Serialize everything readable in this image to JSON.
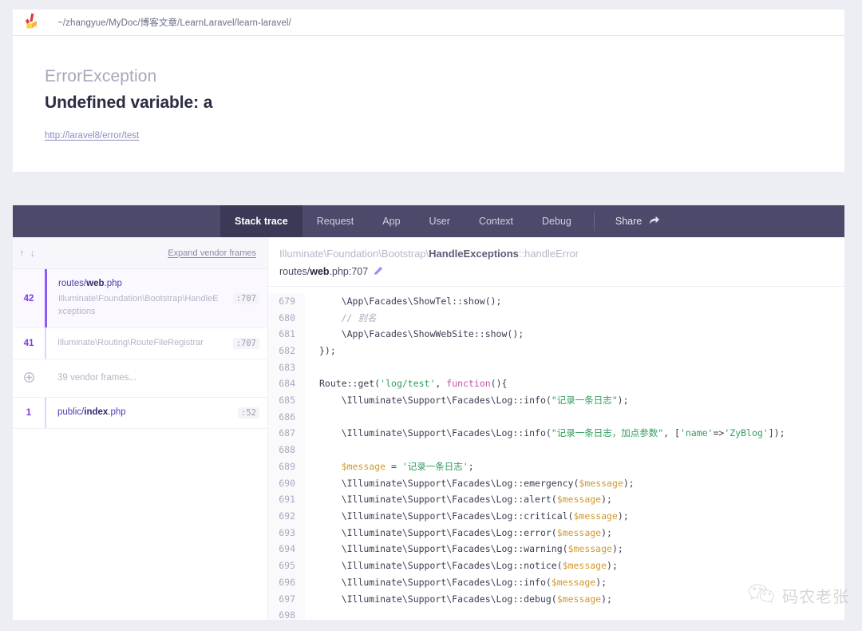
{
  "pathbar": {
    "logo_icon": "laravel-ignition-logo",
    "path": "~/zhangyue/MyDoc/博客文章/LearnLaravel/learn-laravel/"
  },
  "error": {
    "exception_class": "ErrorException",
    "message": "Undefined variable: a",
    "url": "http://laravel8/error/test"
  },
  "tabs": [
    {
      "label": "Stack trace",
      "active": true
    },
    {
      "label": "Request",
      "active": false
    },
    {
      "label": "App",
      "active": false
    },
    {
      "label": "User",
      "active": false
    },
    {
      "label": "Context",
      "active": false
    },
    {
      "label": "Debug",
      "active": false
    }
  ],
  "share": {
    "label": "Share",
    "icon": "share-arrow-icon"
  },
  "frames_panel": {
    "sort_up_icon": "arrow-up-icon",
    "sort_down_icon": "arrow-down-icon",
    "expand_vendor_label": "Expand vendor frames",
    "frames": [
      {
        "number": "42",
        "file": "routes/web.php",
        "file_prefix": "routes/",
        "file_bold": "web",
        "file_suffix": ".php",
        "class": "Illuminate\\Foundation\\Bootstrap\\HandleExceptions",
        "line": ":707",
        "active": true,
        "vendor": false
      },
      {
        "number": "41",
        "file": "",
        "class": "Illuminate\\Routing\\RouteFileRegistrar",
        "line": ":707",
        "active": false,
        "vendor": false
      },
      {
        "number": "",
        "icon": "plus-circle-icon",
        "class": "39 vendor frames...",
        "line": "",
        "active": false,
        "vendor": true
      },
      {
        "number": "1",
        "file": "public/index.php",
        "file_prefix": "public/",
        "file_bold": "index",
        "file_suffix": ".php",
        "class": "",
        "line": ":52",
        "active": false,
        "vendor": false
      }
    ]
  },
  "source_panel": {
    "class_prefix": "Illuminate\\Foundation\\Bootstrap\\",
    "class_bold": "HandleExceptions",
    "class_suffix": "::handleError",
    "file_prefix": "routes/",
    "file_bold": "web",
    "file_suffix": ".php:707",
    "edit_icon": "pencil-icon",
    "code_lines": [
      {
        "n": "679",
        "tokens": [
          {
            "t": "punct",
            "v": "    \\App\\Facades\\ShowTel::show();"
          }
        ]
      },
      {
        "n": "680",
        "tokens": [
          {
            "t": "com",
            "v": "    // 别名"
          }
        ]
      },
      {
        "n": "681",
        "tokens": [
          {
            "t": "punct",
            "v": "    \\App\\Facades\\ShowWebSite::show();"
          }
        ]
      },
      {
        "n": "682",
        "tokens": [
          {
            "t": "punct",
            "v": "});"
          }
        ]
      },
      {
        "n": "683",
        "tokens": [
          {
            "t": "punct",
            "v": ""
          }
        ]
      },
      {
        "n": "684",
        "tokens": [
          {
            "t": "punct",
            "v": "Route::get("
          },
          {
            "t": "str",
            "v": "'log/test'"
          },
          {
            "t": "punct",
            "v": ", "
          },
          {
            "t": "kw",
            "v": "function"
          },
          {
            "t": "punct",
            "v": "(){"
          }
        ]
      },
      {
        "n": "685",
        "tokens": [
          {
            "t": "punct",
            "v": "    \\Illuminate\\Support\\Facades\\Log::info("
          },
          {
            "t": "str",
            "v": "\"记录一条日志\""
          },
          {
            "t": "punct",
            "v": ");"
          }
        ]
      },
      {
        "n": "686",
        "tokens": [
          {
            "t": "punct",
            "v": ""
          }
        ]
      },
      {
        "n": "687",
        "tokens": [
          {
            "t": "punct",
            "v": "    \\Illuminate\\Support\\Facades\\Log::info("
          },
          {
            "t": "str",
            "v": "\"记录一条日志，加点参数\""
          },
          {
            "t": "punct",
            "v": ", ["
          },
          {
            "t": "str",
            "v": "'name'"
          },
          {
            "t": "punct",
            "v": "=>"
          },
          {
            "t": "str",
            "v": "'ZyBlog'"
          },
          {
            "t": "punct",
            "v": "]);"
          }
        ]
      },
      {
        "n": "688",
        "tokens": [
          {
            "t": "punct",
            "v": ""
          }
        ]
      },
      {
        "n": "689",
        "tokens": [
          {
            "t": "var",
            "v": "    $message"
          },
          {
            "t": "punct",
            "v": " = "
          },
          {
            "t": "str",
            "v": "'记录一条日志'"
          },
          {
            "t": "punct",
            "v": ";"
          }
        ]
      },
      {
        "n": "690",
        "tokens": [
          {
            "t": "punct",
            "v": "    \\Illuminate\\Support\\Facades\\Log::emergency("
          },
          {
            "t": "var",
            "v": "$message"
          },
          {
            "t": "punct",
            "v": ");"
          }
        ]
      },
      {
        "n": "691",
        "tokens": [
          {
            "t": "punct",
            "v": "    \\Illuminate\\Support\\Facades\\Log::alert("
          },
          {
            "t": "var",
            "v": "$message"
          },
          {
            "t": "punct",
            "v": ");"
          }
        ]
      },
      {
        "n": "692",
        "tokens": [
          {
            "t": "punct",
            "v": "    \\Illuminate\\Support\\Facades\\Log::critical("
          },
          {
            "t": "var",
            "v": "$message"
          },
          {
            "t": "punct",
            "v": ");"
          }
        ]
      },
      {
        "n": "693",
        "tokens": [
          {
            "t": "punct",
            "v": "    \\Illuminate\\Support\\Facades\\Log::error("
          },
          {
            "t": "var",
            "v": "$message"
          },
          {
            "t": "punct",
            "v": ");"
          }
        ]
      },
      {
        "n": "694",
        "tokens": [
          {
            "t": "punct",
            "v": "    \\Illuminate\\Support\\Facades\\Log::warning("
          },
          {
            "t": "var",
            "v": "$message"
          },
          {
            "t": "punct",
            "v": ");"
          }
        ]
      },
      {
        "n": "695",
        "tokens": [
          {
            "t": "punct",
            "v": "    \\Illuminate\\Support\\Facades\\Log::notice("
          },
          {
            "t": "var",
            "v": "$message"
          },
          {
            "t": "punct",
            "v": ");"
          }
        ]
      },
      {
        "n": "696",
        "tokens": [
          {
            "t": "punct",
            "v": "    \\Illuminate\\Support\\Facades\\Log::info("
          },
          {
            "t": "var",
            "v": "$message"
          },
          {
            "t": "punct",
            "v": ");"
          }
        ]
      },
      {
        "n": "697",
        "tokens": [
          {
            "t": "punct",
            "v": "    \\Illuminate\\Support\\Facades\\Log::debug("
          },
          {
            "t": "var",
            "v": "$message"
          },
          {
            "t": "punct",
            "v": ");"
          }
        ]
      },
      {
        "n": "698",
        "tokens": [
          {
            "t": "punct",
            "v": ""
          }
        ]
      }
    ]
  },
  "watermark": {
    "icon": "wechat-icon",
    "text": "码农老张"
  },
  "colors": {
    "tabbar_bg": "#4c4a6b",
    "tab_active_bg": "#3b3956",
    "accent_purple": "#8b5cf6",
    "page_bg": "#eceef3",
    "string_green": "#2e9e5b",
    "keyword_pink": "#c74fa6",
    "variable_orange": "#d19a2e"
  }
}
